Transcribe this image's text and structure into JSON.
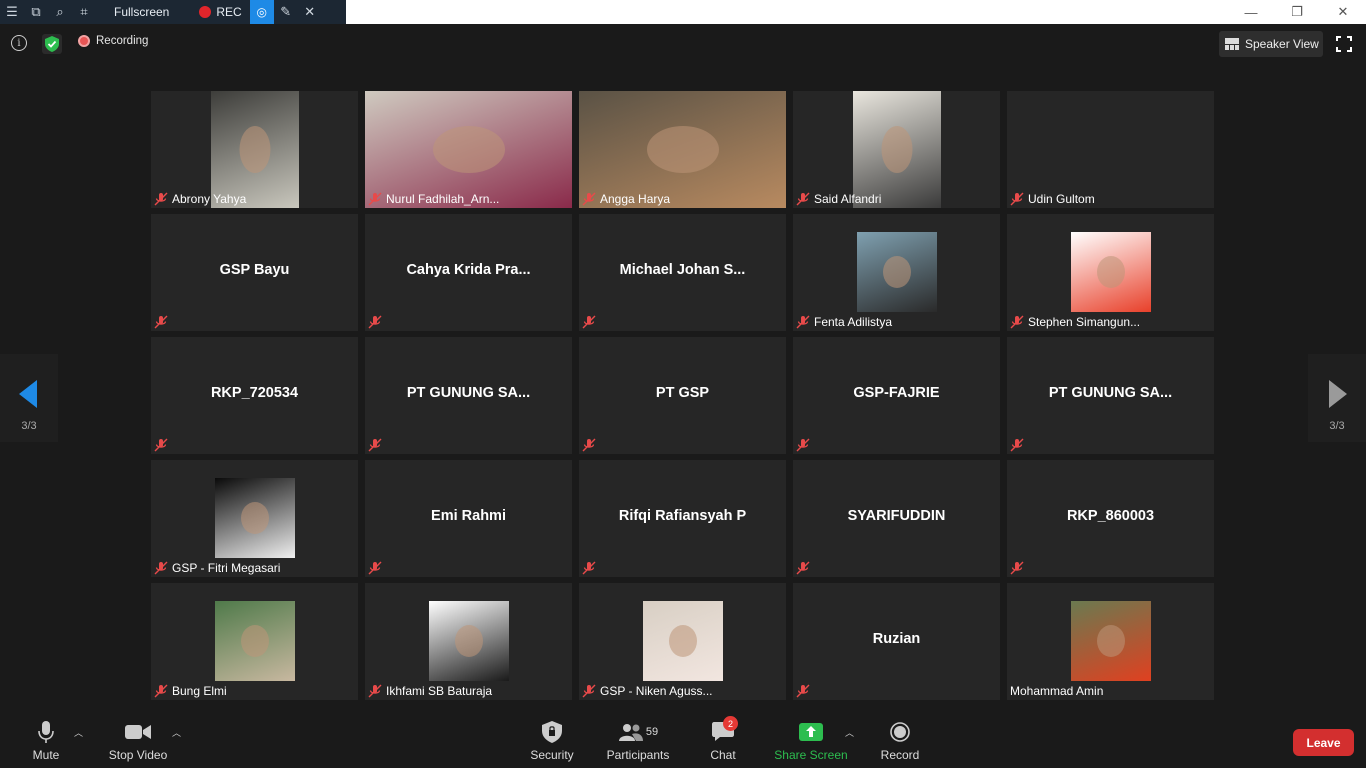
{
  "titlebar": {
    "fullscreen_label": "Fullscreen",
    "rec_label": "REC"
  },
  "topbar": {
    "recording_label": "Recording",
    "speaker_view_label": "Speaker View"
  },
  "pagination": {
    "left_label": "3/3",
    "right_label": "3/3"
  },
  "tiles": [
    {
      "name": "Abrony Yahya",
      "video": true,
      "photo_colors": [
        "#3d3d3a",
        "#c9c7bd"
      ]
    },
    {
      "name": "Nurul Fadhilah_Arn...",
      "video": true,
      "photo_colors": [
        "#cfcac0",
        "#8a2a4a"
      ]
    },
    {
      "name": "Angga Harya",
      "video": true,
      "photo_colors": [
        "#5a5245",
        "#b88a60"
      ]
    },
    {
      "name": "Said Alfandri",
      "video": true,
      "photo_colors": [
        "#e9e6de",
        "#3a3a3a"
      ]
    },
    {
      "name": "Udin Gultom",
      "video": false,
      "display": ""
    },
    {
      "name": "",
      "video": false,
      "display": "GSP Bayu"
    },
    {
      "name": "",
      "video": false,
      "display": "Cahya Krida Pra..."
    },
    {
      "name": "",
      "video": false,
      "display": "Michael Johan S..."
    },
    {
      "name": "Fenta Adilistya",
      "video": true,
      "photo_colors": [
        "#7fa0b0",
        "#2a2a2a"
      ]
    },
    {
      "name": "Stephen Simangun...",
      "video": true,
      "photo_colors": [
        "#ffffff",
        "#e8402a"
      ]
    },
    {
      "name": "",
      "video": false,
      "display": "RKP_720534"
    },
    {
      "name": "",
      "video": false,
      "display": "PT GUNUNG SA..."
    },
    {
      "name": "",
      "video": false,
      "display": "PT GSP"
    },
    {
      "name": "",
      "video": false,
      "display": "GSP-FAJRIE"
    },
    {
      "name": "",
      "video": false,
      "display": "PT GUNUNG SA..."
    },
    {
      "name": "GSP - Fitri Megasari",
      "video": true,
      "photo_colors": [
        "#0a0a0a",
        "#f0f0f0"
      ]
    },
    {
      "name": "",
      "video": false,
      "display": "Emi Rahmi"
    },
    {
      "name": "",
      "video": false,
      "display": "Rifqi Rafiansyah P"
    },
    {
      "name": "",
      "video": false,
      "display": "SYARIFUDDIN"
    },
    {
      "name": "",
      "video": false,
      "display": "RKP_860003"
    },
    {
      "name": "Bung Elmi",
      "video": true,
      "photo_colors": [
        "#4f7a4a",
        "#c8b8a0"
      ]
    },
    {
      "name": "Ikhfami SB Baturaja",
      "video": true,
      "photo_colors": [
        "#ffffff",
        "#1a1a1a"
      ]
    },
    {
      "name": "GSP - Niken Aguss...",
      "video": true,
      "photo_colors": [
        "#d8cfc4",
        "#f2e6e0"
      ]
    },
    {
      "name": "",
      "video": false,
      "display": "Ruzian"
    },
    {
      "name": "Mohammad Amin",
      "video": true,
      "photo_colors": [
        "#6a7a50",
        "#e04020"
      ]
    }
  ],
  "toolbar": {
    "mute_label": "Mute",
    "stop_video_label": "Stop Video",
    "security_label": "Security",
    "participants_label": "Participants",
    "participants_count": "59",
    "chat_label": "Chat",
    "chat_badge": "2",
    "share_screen_label": "Share Screen",
    "record_label": "Record",
    "leave_label": "Leave"
  },
  "colors": {
    "tile_bg": "#262626",
    "share_green": "#2dbd4f",
    "leave_red": "#d32f2f",
    "accent_blue": "#1e8ae6"
  }
}
